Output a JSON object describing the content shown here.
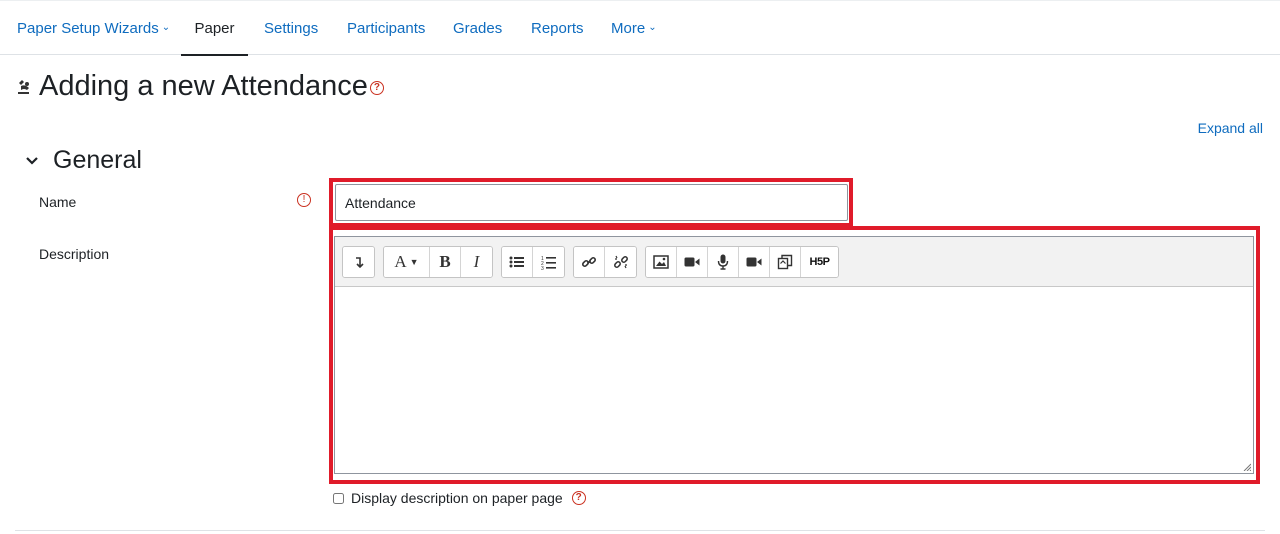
{
  "nav": {
    "items": [
      {
        "label": "Paper Setup Wizards",
        "dropdown": true,
        "active": false
      },
      {
        "label": "Paper",
        "dropdown": false,
        "active": true
      },
      {
        "label": "Settings",
        "dropdown": false,
        "active": false
      },
      {
        "label": "Participants",
        "dropdown": false,
        "active": false
      },
      {
        "label": "Grades",
        "dropdown": false,
        "active": false
      },
      {
        "label": "Reports",
        "dropdown": false,
        "active": false
      },
      {
        "label": "More",
        "dropdown": true,
        "active": false
      }
    ]
  },
  "page": {
    "title": "Adding a new Attendance",
    "expand_all": "Expand all"
  },
  "section": {
    "title": "General"
  },
  "form": {
    "name_label": "Name",
    "name_value": "Attendance",
    "description_label": "Description",
    "display_description_label": "Display description on paper page",
    "display_description_checked": false
  },
  "editor_toolbar": {
    "groups": [
      [
        "collapse-toggle"
      ],
      [
        "font-style",
        "bold",
        "italic"
      ],
      [
        "unordered-list",
        "ordered-list"
      ],
      [
        "link",
        "unlink"
      ],
      [
        "image",
        "video",
        "record-audio",
        "record-video",
        "manage-files",
        "h5p"
      ]
    ],
    "labels": {
      "bold": "B",
      "italic": "I",
      "font": "A",
      "h5p": "H5P"
    }
  },
  "colors": {
    "link": "#0f6cbf",
    "highlight": "#e01b2a",
    "required": "#ca3120",
    "text": "#1d2125"
  }
}
